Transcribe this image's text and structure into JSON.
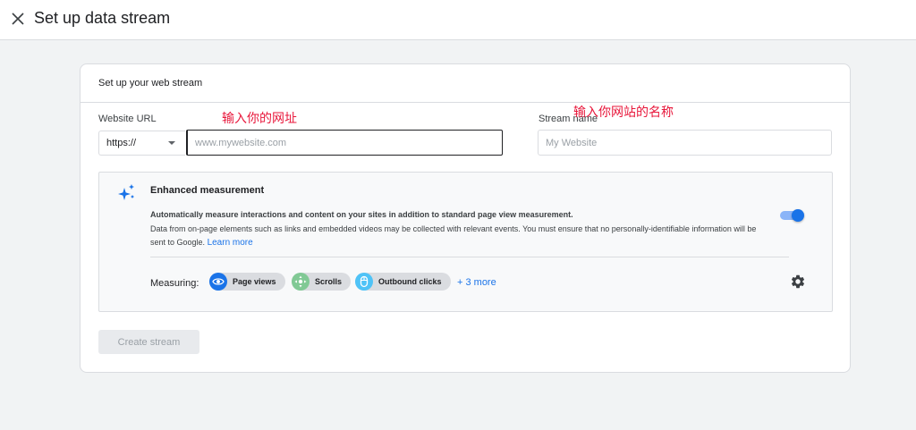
{
  "header": {
    "title": "Set up data stream",
    "close_icon": "close-icon"
  },
  "card": {
    "title": "Set up your web stream",
    "website_url_label": "Website URL",
    "url_annotation": "输入你的网址",
    "stream_name_label": "Stream name",
    "name_annotation": "输入你网站的名称",
    "protocol_value": "https://",
    "url_placeholder": "www.mywebsite.com",
    "name_placeholder": "My Website",
    "create_button": "Create stream"
  },
  "enhanced": {
    "title": "Enhanced measurement",
    "description_bold": "Automatically measure interactions and content on your sites in addition to standard page view measurement.",
    "description": "Data from on-page elements such as links and embedded videos may be collected with relevant events. You must ensure that no personally-identifiable information will be sent to Google.",
    "learn_more": "Learn more",
    "toggle_on": true,
    "measuring_label": "Measuring:",
    "chips": [
      {
        "label": "Page views",
        "icon": "eye-icon",
        "color": "#1a73e8"
      },
      {
        "label": "Scrolls",
        "icon": "crosshair-icon",
        "color": "#81c995"
      },
      {
        "label": "Outbound clicks",
        "icon": "mouse-icon",
        "color": "#4fc3f7"
      }
    ],
    "more_link": "+ 3 more"
  },
  "colors": {
    "accent": "#1a73e8",
    "annotation": "#e8173b"
  }
}
